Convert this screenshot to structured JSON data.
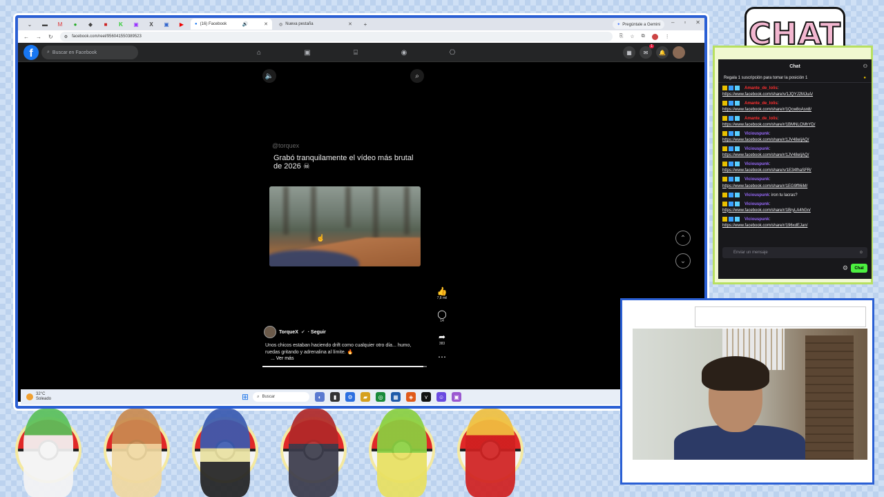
{
  "browser": {
    "tabs": [
      {
        "label": "(16) Facebook",
        "active": true
      },
      {
        "label": "Nueva pestaña",
        "active": false
      }
    ],
    "gemini_label": "Pregúntale a Gemini",
    "url": "facebook.com/reel/956041550389523"
  },
  "facebook": {
    "search_placeholder": "Buscar en Facebook",
    "notification_count": "1",
    "reel": {
      "handle": "@torquex",
      "title": "Grabó tranquilamente el vídeo más brutal de 2026 ☠",
      "likes": "7,8 mil",
      "comments": "14",
      "shares": "383",
      "author": "TorqueX",
      "follow": "· Seguir",
      "description": "Unos chicos estaban haciendo drift como cualquier otro día... humo, ruedas gritando y adrenalina al límite. 🔥",
      "see_more": "... Ver más",
      "progress": 0.98
    }
  },
  "taskbar": {
    "weather_temp": "32°C",
    "weather_desc": "Soleado",
    "search_label": "Buscar"
  },
  "chat": {
    "logo_text": "CHAT",
    "header": "Chat",
    "pinned": "Regala 1 suscripción para tomar la posición 1",
    "input_placeholder": "Enviar un mensaje",
    "send_label": "Chat",
    "messages": [
      {
        "user": "Amante_de_lolis",
        "color": "#ff3030",
        "text": "",
        "link": "https://www.facebook.com/share/v/1JQYJ2MJuA/"
      },
      {
        "user": "Amante_de_lolis",
        "color": "#ff3030",
        "text": "",
        "link": "https://www.facebook.com/share/r/1Qcw8oAsn8/"
      },
      {
        "user": "Amante_de_lolis",
        "color": "#ff3030",
        "text": "",
        "link": "https://www.facebook.com/share/r/1BMNLCMhYD/"
      },
      {
        "user": "Viciouspunk",
        "color": "#9b6bff",
        "text": "",
        "link": "https://www.facebook.com/share/r/1JV48eIjAQ/"
      },
      {
        "user": "Viciouspunk",
        "color": "#9b6bff",
        "text": "",
        "link": "https://www.facebook.com/share/r/1JV48eIjAQ/"
      },
      {
        "user": "Viciouspunk",
        "color": "#9b6bff",
        "text": "",
        "link": "https://www.facebook.com/share/v/1E34fhaSFR/"
      },
      {
        "user": "Viciouspunk",
        "color": "#9b6bff",
        "text": "",
        "link": "https://www.facebook.com/share/r/1EG9ffI6iM/"
      },
      {
        "user": "Viciouspunk",
        "color": "#9b6bff",
        "text": "iron tu lacras?",
        "link": ""
      },
      {
        "user": "Viciouspunk",
        "color": "#9b6bff",
        "text": "",
        "link": "https://www.facebook.com/share/r/1BryLA4hGn/"
      },
      {
        "user": "Viciouspunk",
        "color": "#9b6bff",
        "text": "",
        "link": "https://www.facebook.com/share/r/196xdEJan/"
      }
    ]
  },
  "pokemon": [
    "gardevoir",
    "lopunny",
    "lucario",
    "zoroark",
    "leavanny",
    "delphox"
  ],
  "colors": {
    "facebook_blue": "#1877f2",
    "frame_blue": "#2a5fd4",
    "chat_green": "#4cf040"
  }
}
